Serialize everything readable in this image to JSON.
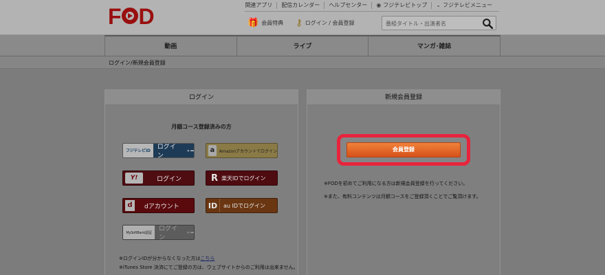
{
  "header": {
    "logo": "FOD",
    "top_links": [
      {
        "label": "関連アプリ"
      },
      {
        "label": "配信カレンダー"
      },
      {
        "label": "ヘルプセンター"
      },
      {
        "label": "フジテレビトップ"
      },
      {
        "label": "フジテレビメニュー"
      }
    ],
    "member_special": "会員特典",
    "login_register": "ログイン / 会員登録",
    "search_placeholder": "番組タイトル・出演者名"
  },
  "nav": {
    "tabs": [
      {
        "label": "動画"
      },
      {
        "label": "ライブ"
      },
      {
        "label": "マンガ･雑誌"
      }
    ]
  },
  "breadcrumb": "ログイン/新規会員登録",
  "login_panel": {
    "title": "ログイン",
    "subtitle": "月額コース登録済みの方",
    "buttons": {
      "fuji_prefix": "フジテレビID",
      "fuji_label": "ログイン",
      "amazon_label": "Amazonアカウントでログイン",
      "yahoo_prefix": "Y!",
      "yahoo_label": "ログイン",
      "rakuten_prefix": "R",
      "rakuten_label": "楽天IDでログイン",
      "d_prefix": "d",
      "d_label": "dアカウント",
      "au_prefix": "ID",
      "au_label": "au IDでログイン",
      "softbank_prefix": "MySoftBank認証",
      "softbank_label": "ログイン"
    },
    "note1_text": "※ログインIDが分からなくなった方は",
    "note1_link": "こちら",
    "note2_text": "※iTunes Store 決済にてご登録の方は、ウェブサイトからのご利用は出来ません。"
  },
  "register_panel": {
    "title": "新規会員登録",
    "button_label": "会員登録",
    "note1": "※FODを初めてご利用になる方は新規会員登録を行ってください。",
    "note2": "※また、有料コンテンツは月額コースをご登録頂くことでご覧頂けます。",
    "highlight_color": "#e8243c"
  }
}
